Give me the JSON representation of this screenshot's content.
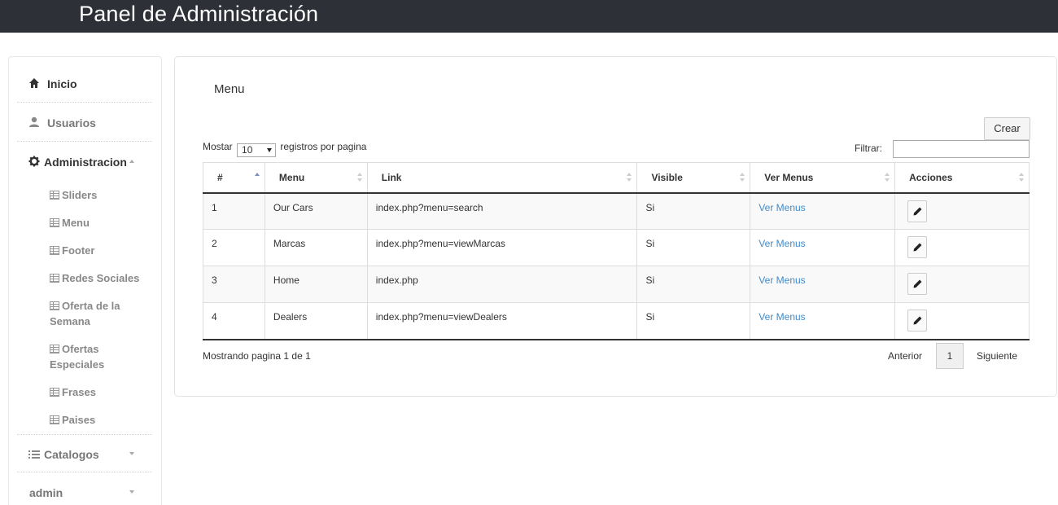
{
  "header": {
    "title": "Panel de Administración"
  },
  "sidebar": {
    "items": [
      {
        "label": "Inicio",
        "icon": "home-icon"
      },
      {
        "label": "Usuarios",
        "icon": "user-icon"
      },
      {
        "label": "Administracion",
        "icon": "gear-icon",
        "expanded": true
      },
      {
        "label": "Catalogos",
        "icon": "list-icon",
        "expanded": false
      },
      {
        "label": "admin",
        "icon": "",
        "expanded": false
      }
    ],
    "sub_items": [
      "Sliders",
      "Menu",
      "Footer",
      "Redes Sociales",
      "Oferta de la Semana",
      "Ofertas Especiales",
      "Frases",
      "Paises"
    ]
  },
  "panel": {
    "title": "Menu",
    "create_label": "Crear",
    "length_prefix": "Mostar",
    "length_value": "10",
    "length_suffix": "registros por pagina",
    "filter_label": "Filtrar:",
    "filter_value": ""
  },
  "table": {
    "columns": [
      "#",
      "Menu",
      "Link",
      "Visible",
      "Ver Menus",
      "Acciones"
    ],
    "rows": [
      {
        "id": "1",
        "menu": "Our Cars",
        "link": "index.php?menu=search",
        "visible": "Si",
        "ver": "Ver Menus"
      },
      {
        "id": "2",
        "menu": "Marcas",
        "link": "index.php?menu=viewMarcas",
        "visible": "Si",
        "ver": "Ver Menus"
      },
      {
        "id": "3",
        "menu": "Home",
        "link": "index.php",
        "visible": "Si",
        "ver": "Ver Menus"
      },
      {
        "id": "4",
        "menu": "Dealers",
        "link": "index.php?menu=viewDealers",
        "visible": "Si",
        "ver": "Ver Menus"
      }
    ]
  },
  "footer": {
    "info": "Mostrando pagina 1 de 1",
    "prev": "Anterior",
    "current_page": "1",
    "next": "Siguiente"
  },
  "colors": {
    "topbar": "#2d3137",
    "link": "#428bca"
  }
}
